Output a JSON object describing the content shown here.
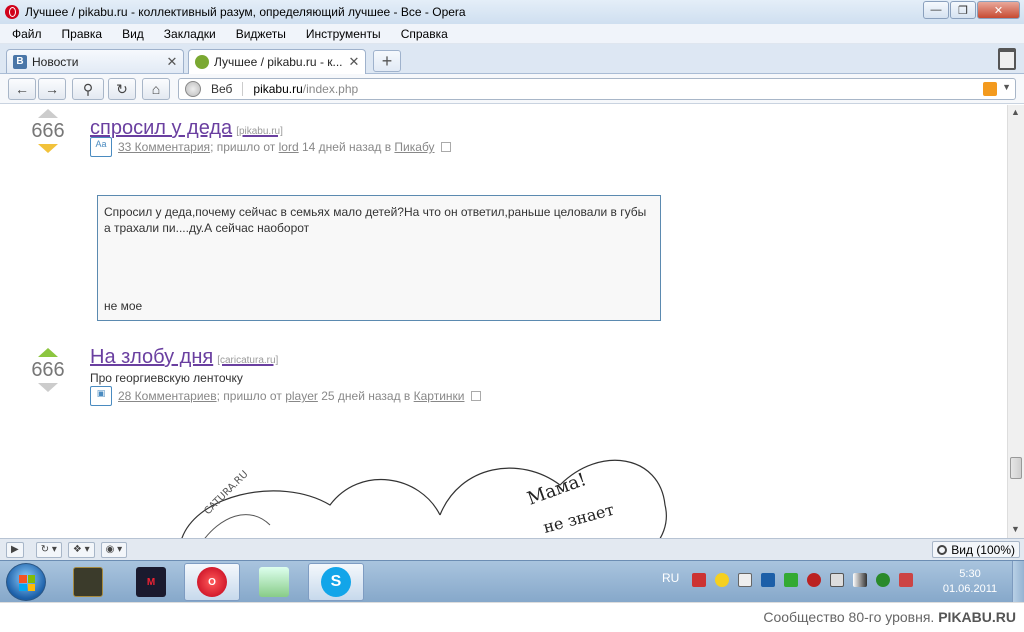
{
  "window": {
    "title": "Лучшее / pikabu.ru - коллективный разум, определяющий лучшее - Все - Opera"
  },
  "menu": {
    "items": [
      "Файл",
      "Правка",
      "Вид",
      "Закладки",
      "Виджеты",
      "Инструменты",
      "Справка"
    ]
  },
  "tabs": [
    {
      "label": "Новости",
      "icon": "vk-icon"
    },
    {
      "label": "Лучшее / pikabu.ru - к...",
      "icon": "pikabu-icon"
    }
  ],
  "address": {
    "web_label": "Веб",
    "host": "pikabu.ru",
    "path": "/index.php"
  },
  "posts": [
    {
      "score": "666",
      "title": "спросил у деда",
      "source": "[pikabu.ru]",
      "type_icon": "Аа",
      "comments": "33 Комментария",
      "meta_mid": "; пришло от",
      "author": "lord",
      "meta_time": "14 дней назад в",
      "category": "Пикабу",
      "text": "Спросил у деда,почему сейчас в семьях мало детей?На что он ответил,раньше целовали в губы а трахали пи....ду.А сейчас наоборот",
      "signature": "не мое"
    },
    {
      "score": "666",
      "title": "На злобу дня",
      "source": "[caricatura.ru]",
      "subtitle": "Про георгиевскую ленточку",
      "comments": "28 Комментариев",
      "meta_mid": "; пришло от",
      "author": "player",
      "meta_time": "25 дней назад в",
      "category": "Картинки",
      "cartoon_text_1": "Мама!",
      "cartoon_text_2": "не знает",
      "cartoon_text_3": "CATURA.RU"
    }
  ],
  "statusbar": {
    "zoom_label": "Вид (100%)"
  },
  "taskbar": {
    "lang": "RU",
    "time": "5:30",
    "date": "01.06.2011"
  },
  "footer": {
    "text": "Сообщество 80-го уровня.",
    "brand": "PIKABU.RU"
  },
  "colors": {
    "title_link": "#6a3fa0",
    "vote_up": "#8cc63f",
    "vote_down": "#f2c23a",
    "accent": "#4a8bc0"
  }
}
